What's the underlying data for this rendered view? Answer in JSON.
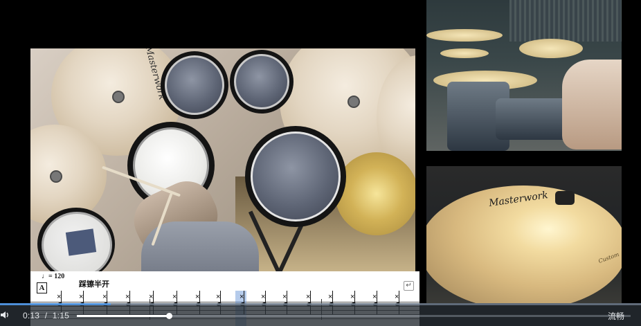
{
  "score": {
    "tempo": "♩= 120",
    "section": "A",
    "technique": "踩镲半开",
    "repeat_icon": "return-arrow-icon"
  },
  "player": {
    "current_time": "0:13",
    "separator": "/",
    "duration": "1:15",
    "progress_fraction": 0.173,
    "quality": "流畅",
    "play_icon": "pause-icon",
    "volume_icon": "speaker-icon",
    "accent": "#4d8fd8"
  },
  "cameras": {
    "main_brand": "Masterwork",
    "closeup_brand": "Masterwork",
    "closeup_sub": "Custom"
  }
}
